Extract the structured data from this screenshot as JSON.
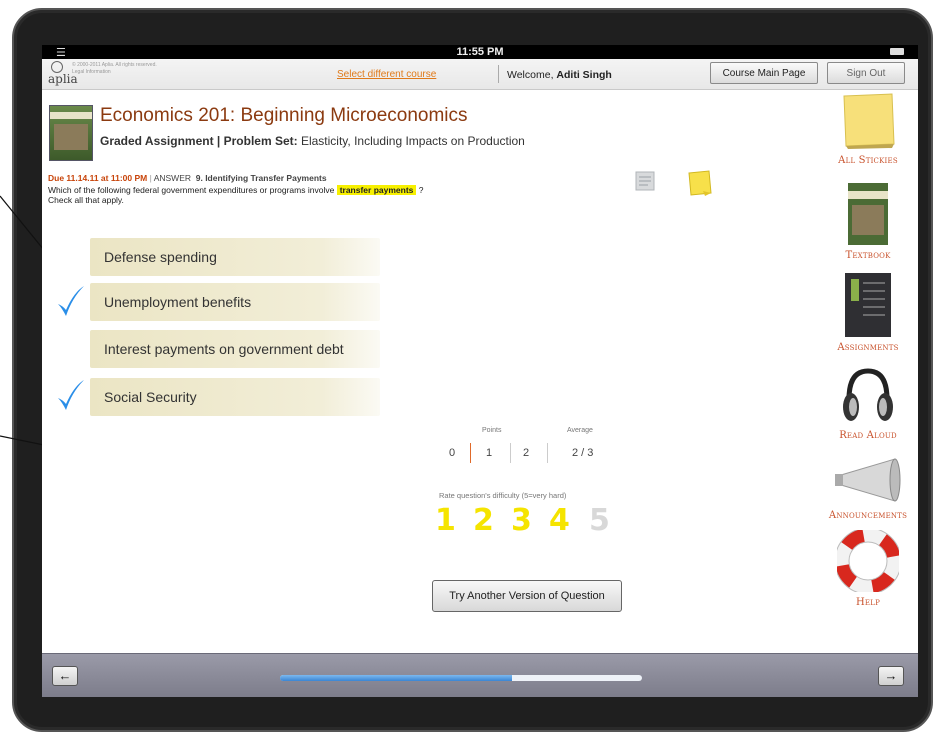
{
  "status_bar": {
    "time": "11:55 PM"
  },
  "header": {
    "logo": "aplia",
    "copyright_line1": "© 2000-2011 Aplia. All rights reserved.",
    "copyright_line2": "Legal Information",
    "select_course_link": "Select different course",
    "welcome_prefix": "Welcome, ",
    "user_name": "Aditi Singh",
    "course_main_button": "Course Main Page",
    "sign_out_button": "Sign Out"
  },
  "course": {
    "title": "Economics 201: Beginning Microeconomics",
    "assignment_type": "Graded Assignment | Problem Set:",
    "assignment_name": " Elasticity, Including Impacts on Production"
  },
  "question": {
    "due_label": "Due 11.14.11 at 11:00 PM",
    "separator": " | ",
    "answer_label": "ANSWER",
    "number_title": "9. Identifying Transfer Payments",
    "text_before": "Which of the following federal government expenditures or programs involve ",
    "highlight": "transfer payments",
    "text_after": " ?",
    "instruction": "Check all that apply."
  },
  "options": [
    {
      "label": "Defense spending",
      "checked": false
    },
    {
      "label": "Unemployment benefits",
      "checked": true
    },
    {
      "label": "Interest payments on government debt",
      "checked": false
    },
    {
      "label": "Social Security",
      "checked": true
    }
  ],
  "stats": {
    "points_label": "Points",
    "average_label": "Average",
    "points_values": [
      "0",
      "1",
      "2"
    ],
    "average_value": "2 / 3"
  },
  "difficulty": {
    "label": "Rate question's difficulty (5=very hard)",
    "ratings": [
      "1",
      "2",
      "3",
      "4",
      "5"
    ],
    "selected": 4,
    "active_color": "#f5e400",
    "inactive_color": "#d8d8d8"
  },
  "try_another_button": "Try Another Version of Question",
  "sidebar": [
    {
      "label": "All Stickies",
      "icon": "sticky-note-icon"
    },
    {
      "label": "Textbook",
      "icon": "textbook-icon"
    },
    {
      "label": "Assignments",
      "icon": "assignments-icon"
    },
    {
      "label": "Read Aloud",
      "icon": "headphones-icon"
    },
    {
      "label": "Announcements",
      "icon": "megaphone-icon"
    },
    {
      "label": "Help",
      "icon": "life-ring-icon"
    }
  ],
  "footer": {
    "progress_fraction": 0.64
  },
  "colors": {
    "accent_orange": "#c8502a",
    "title_brown": "#8b3a10",
    "check_blue": "#2a8ee8",
    "highlight": "#f7f000"
  }
}
